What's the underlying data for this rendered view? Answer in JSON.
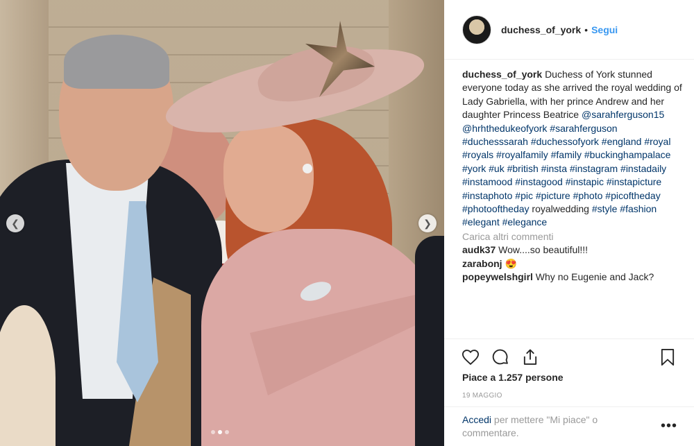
{
  "photo": {
    "nav_prev_icon": "chevron-left-icon",
    "nav_next_icon": "chevron-right-icon",
    "carousel": {
      "count": 3,
      "active": 1
    }
  },
  "post": {
    "author": "duchess_of_york",
    "separator": "•",
    "follow_label": "Segui",
    "caption": "Duchess of York stunned everyone today as she arrived the royal wedding of Lady Gabriella, with her prince Andrew and her daughter Princess Beatrice",
    "mentions": [
      "@sarahferguson15",
      "@hrhthedukeofyork"
    ],
    "hashtags_a": [
      "#sarahferguson",
      "#duchesssarah",
      "#duchessofyork",
      "#england",
      "#royal",
      "#royals",
      "#royalfamily",
      "#family",
      "#buckinghampalace",
      "#york",
      "#uk",
      "#british",
      "#insta",
      "#instagram",
      "#instadaily",
      "#instamood",
      "#instagood",
      "#instapic",
      "#instapicture",
      "#instaphoto",
      "#pic",
      "#picture",
      "#photo",
      "#picoftheday",
      "#photooftheday"
    ],
    "plain_word": "royalwedding",
    "hashtags_b": [
      "#style",
      "#fashion",
      "#elegant",
      "#elegance"
    ],
    "load_more": "Carica altri commenti",
    "comments": [
      {
        "user": "audk37",
        "text": "Wow....so beautiful!!!"
      },
      {
        "user": "zarabonj",
        "text": "😍"
      },
      {
        "user": "popeywelshgirl",
        "text": "Why no Eugenie and Jack?"
      }
    ],
    "likes": "Piace a 1.257 persone",
    "date": "19 MAGGIO",
    "login_link": "Accedi",
    "login_rest": "per mettere \"Mi piace\" o commentare.",
    "more_label": "•••"
  },
  "icons": {
    "like": "heart-icon",
    "comment": "comment-bubble-icon",
    "share": "share-icon",
    "save": "bookmark-icon"
  },
  "colors": {
    "link": "#003569",
    "follow": "#3897f0",
    "muted": "#999999",
    "text": "#262626"
  }
}
